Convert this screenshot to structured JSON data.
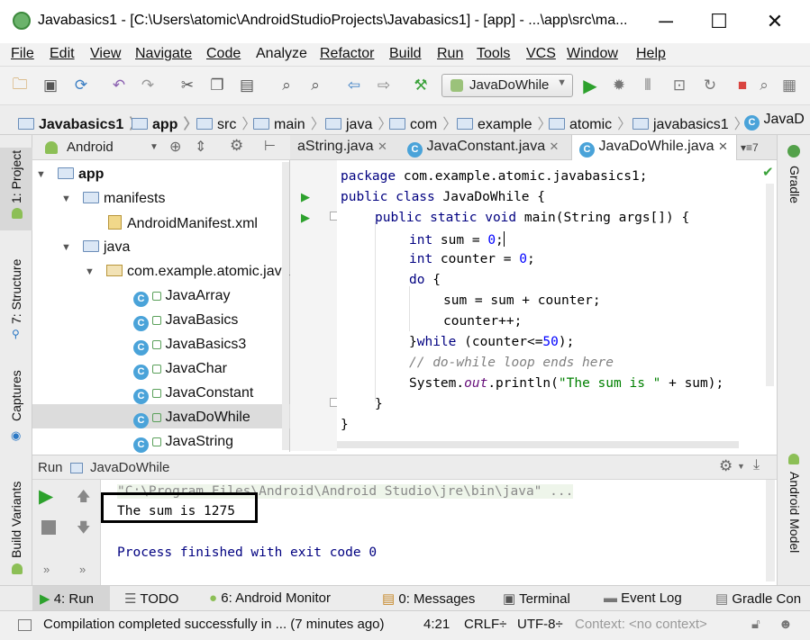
{
  "window": {
    "title": "Javabasics1 - [C:\\Users\\atomic\\AndroidStudioProjects\\Javabasics1] - [app] - ...\\app\\src\\ma...",
    "minimize": "─",
    "maximize": "☐",
    "close": "✕"
  },
  "menu": [
    "File",
    "Edit",
    "View",
    "Navigate",
    "Code",
    "Analyze",
    "Refactor",
    "Build",
    "Run",
    "Tools",
    "VCS",
    "Window",
    "Help"
  ],
  "toolbar": {
    "run_config": "JavaDoWhile"
  },
  "breadcrumb": [
    "Javabasics1",
    "app",
    "src",
    "main",
    "java",
    "com",
    "example",
    "atomic",
    "javabasics1",
    "JavaD"
  ],
  "left_stripe": {
    "project": "1: Project",
    "structure": "7: Structure",
    "captures": "Captures",
    "build_variants": "Build Variants"
  },
  "right_stripe": {
    "gradle": "Gradle",
    "android_model": "Android Model"
  },
  "project": {
    "view_mode": "Android",
    "tree": [
      {
        "label": "app",
        "level": 0,
        "kind": "module"
      },
      {
        "label": "manifests",
        "level": 1,
        "kind": "folder"
      },
      {
        "label": "AndroidManifest.xml",
        "level": 2,
        "kind": "xml"
      },
      {
        "label": "java",
        "level": 1,
        "kind": "folder"
      },
      {
        "label": "com.example.atomic.java",
        "level": 2,
        "kind": "package"
      },
      {
        "label": "JavaArray",
        "level": 3,
        "kind": "class"
      },
      {
        "label": "JavaBasics",
        "level": 3,
        "kind": "class"
      },
      {
        "label": "JavaBasics3",
        "level": 3,
        "kind": "class"
      },
      {
        "label": "JavaChar",
        "level": 3,
        "kind": "class"
      },
      {
        "label": "JavaConstant",
        "level": 3,
        "kind": "class"
      },
      {
        "label": "JavaDoWhile",
        "level": 3,
        "kind": "class"
      },
      {
        "label": "JavaString",
        "level": 3,
        "kind": "class"
      }
    ],
    "selected": "JavaDoWhile"
  },
  "editor": {
    "tabs": [
      "aString.java",
      "JavaConstant.java",
      "JavaDoWhile.java"
    ],
    "active_tab": "JavaDoWhile.java",
    "tab_overflow": "7",
    "code": {
      "l1_kw": "package",
      "l1": " com.example.atomic.javabasics1;",
      "l2_kw": "public class",
      "l2": " JavaDoWhile {",
      "l3_kw": "public static void",
      "l3": " main(String args[]) {",
      "l4_kw": "int",
      "l4a": " sum = ",
      "l4_num": "0",
      "l4b": ";",
      "l5_kw": "int",
      "l5a": " counter = ",
      "l5_num": "0",
      "l5b": ";",
      "l6_kw": "do",
      "l6": " {",
      "l7": "sum = sum + counter;",
      "l8": "counter++;",
      "l9a": "}",
      "l9_kw": "while",
      "l9b": " (counter<=",
      "l9_num": "50",
      "l9c": ");",
      "l10": "// do-while loop ends here",
      "l11a": "System.",
      "l11_fld": "out",
      "l11b": ".println(",
      "l11_str": "\"The sum is \"",
      "l11c": " + sum);",
      "l12": "}",
      "l13": "}"
    }
  },
  "run": {
    "label": "Run",
    "config": "JavaDoWhile",
    "console": {
      "cmd": "\"C:\\Program Files\\Android\\Android Studio\\jre\\bin\\java\" ...",
      "output": "The sum is 1275",
      "exit": "Process finished with exit code 0"
    }
  },
  "bottom_tools": [
    {
      "label": "4: Run"
    },
    {
      "label": "TODO"
    },
    {
      "label": "6: Android Monitor"
    },
    {
      "label": "0: Messages"
    },
    {
      "label": "Terminal"
    },
    {
      "label": "Event Log"
    },
    {
      "label": "Gradle Con"
    }
  ],
  "status": {
    "message": "Compilation completed successfully in ... (7 minutes ago)",
    "position": "4:21",
    "line_sep": "CRLF÷",
    "encoding": "UTF-8÷",
    "context": "Context: <no context>"
  },
  "colors": {
    "keyword": "#000080",
    "string": "#008000",
    "comment": "#808080",
    "console_text": "#000080",
    "run_green": "#2da12d"
  }
}
